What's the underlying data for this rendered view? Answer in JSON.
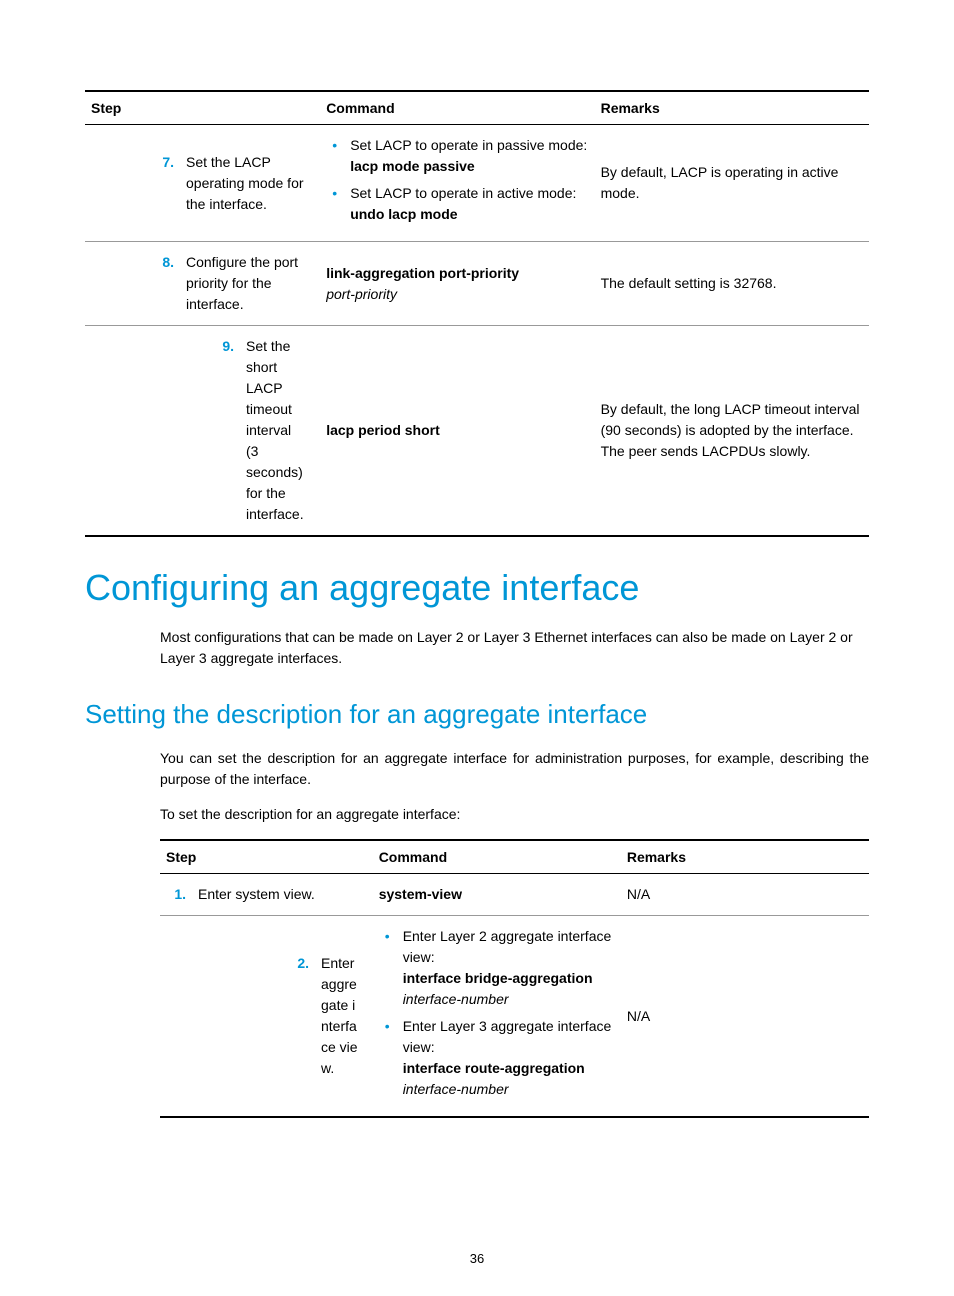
{
  "table1": {
    "headers": {
      "step": "Step",
      "command": "Command",
      "remarks": "Remarks"
    },
    "rows": [
      {
        "num": "7.",
        "step": "Set the LACP operating mode for the interface.",
        "cmd_items": [
          {
            "intro": "Set LACP to operate in passive mode:",
            "cmd": "lacp mode passive"
          },
          {
            "intro": "Set LACP to operate in active mode:",
            "cmd": "undo lacp mode"
          }
        ],
        "remarks": "By default, LACP is operating in active mode."
      },
      {
        "num": "8.",
        "step": "Configure the port priority for the interface.",
        "cmd_bold": "link-aggregation port-priority",
        "cmd_italic": "port-priority",
        "remarks": "The default setting is 32768."
      },
      {
        "num": "9.",
        "step": "Set the short LACP timeout interval (3 seconds) for the interface.",
        "cmd_bold": "lacp period short",
        "remarks": "By default, the long LACP timeout interval (90 seconds) is adopted by the interface. The peer sends LACPDUs slowly."
      }
    ]
  },
  "heading1": "Configuring an aggregate interface",
  "para1": "Most configurations that can be made on Layer 2 or Layer 3 Ethernet interfaces can also be made on Layer 2 or Layer 3 aggregate interfaces.",
  "heading2": "Setting the description for an aggregate interface",
  "para2": "You can set the description for an aggregate interface for administration purposes, for example, describing the purpose of the interface.",
  "para3": "To set the description for an aggregate interface:",
  "table2": {
    "headers": {
      "step": "Step",
      "command": "Command",
      "remarks": "Remarks"
    },
    "rows": [
      {
        "num": "1.",
        "step": "Enter system view.",
        "cmd_bold": "system-view",
        "remarks": "N/A"
      },
      {
        "num": "2.",
        "step": "Enter aggregate interface view.",
        "cmd_items": [
          {
            "intro": "Enter Layer 2 aggregate interface view:",
            "cmd": "interface bridge-aggregation",
            "arg": "interface-number"
          },
          {
            "intro": "Enter Layer 3 aggregate interface view:",
            "cmd": "interface route-aggregation",
            "arg": "interface-number"
          }
        ],
        "remarks": "N/A"
      }
    ]
  },
  "pageNumber": "36"
}
